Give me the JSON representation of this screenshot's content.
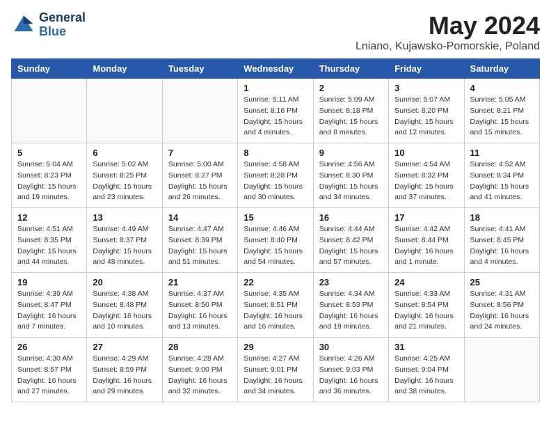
{
  "header": {
    "logo_general": "General",
    "logo_blue": "Blue",
    "month_title": "May 2024",
    "location": "Lniano, Kujawsko-Pomorskie, Poland"
  },
  "weekdays": [
    "Sunday",
    "Monday",
    "Tuesday",
    "Wednesday",
    "Thursday",
    "Friday",
    "Saturday"
  ],
  "weeks": [
    [
      {
        "day": "",
        "info": ""
      },
      {
        "day": "",
        "info": ""
      },
      {
        "day": "",
        "info": ""
      },
      {
        "day": "1",
        "info": "Sunrise: 5:11 AM\nSunset: 8:16 PM\nDaylight: 15 hours\nand 4 minutes."
      },
      {
        "day": "2",
        "info": "Sunrise: 5:09 AM\nSunset: 8:18 PM\nDaylight: 15 hours\nand 8 minutes."
      },
      {
        "day": "3",
        "info": "Sunrise: 5:07 AM\nSunset: 8:20 PM\nDaylight: 15 hours\nand 12 minutes."
      },
      {
        "day": "4",
        "info": "Sunrise: 5:05 AM\nSunset: 8:21 PM\nDaylight: 15 hours\nand 15 minutes."
      }
    ],
    [
      {
        "day": "5",
        "info": "Sunrise: 5:04 AM\nSunset: 8:23 PM\nDaylight: 15 hours\nand 19 minutes."
      },
      {
        "day": "6",
        "info": "Sunrise: 5:02 AM\nSunset: 8:25 PM\nDaylight: 15 hours\nand 23 minutes."
      },
      {
        "day": "7",
        "info": "Sunrise: 5:00 AM\nSunset: 8:27 PM\nDaylight: 15 hours\nand 26 minutes."
      },
      {
        "day": "8",
        "info": "Sunrise: 4:58 AM\nSunset: 8:28 PM\nDaylight: 15 hours\nand 30 minutes."
      },
      {
        "day": "9",
        "info": "Sunrise: 4:56 AM\nSunset: 8:30 PM\nDaylight: 15 hours\nand 34 minutes."
      },
      {
        "day": "10",
        "info": "Sunrise: 4:54 AM\nSunset: 8:32 PM\nDaylight: 15 hours\nand 37 minutes."
      },
      {
        "day": "11",
        "info": "Sunrise: 4:52 AM\nSunset: 8:34 PM\nDaylight: 15 hours\nand 41 minutes."
      }
    ],
    [
      {
        "day": "12",
        "info": "Sunrise: 4:51 AM\nSunset: 8:35 PM\nDaylight: 15 hours\nand 44 minutes."
      },
      {
        "day": "13",
        "info": "Sunrise: 4:49 AM\nSunset: 8:37 PM\nDaylight: 15 hours\nand 48 minutes."
      },
      {
        "day": "14",
        "info": "Sunrise: 4:47 AM\nSunset: 8:39 PM\nDaylight: 15 hours\nand 51 minutes."
      },
      {
        "day": "15",
        "info": "Sunrise: 4:46 AM\nSunset: 8:40 PM\nDaylight: 15 hours\nand 54 minutes."
      },
      {
        "day": "16",
        "info": "Sunrise: 4:44 AM\nSunset: 8:42 PM\nDaylight: 15 hours\nand 57 minutes."
      },
      {
        "day": "17",
        "info": "Sunrise: 4:42 AM\nSunset: 8:44 PM\nDaylight: 16 hours\nand 1 minute."
      },
      {
        "day": "18",
        "info": "Sunrise: 4:41 AM\nSunset: 8:45 PM\nDaylight: 16 hours\nand 4 minutes."
      }
    ],
    [
      {
        "day": "19",
        "info": "Sunrise: 4:39 AM\nSunset: 8:47 PM\nDaylight: 16 hours\nand 7 minutes."
      },
      {
        "day": "20",
        "info": "Sunrise: 4:38 AM\nSunset: 8:48 PM\nDaylight: 16 hours\nand 10 minutes."
      },
      {
        "day": "21",
        "info": "Sunrise: 4:37 AM\nSunset: 8:50 PM\nDaylight: 16 hours\nand 13 minutes."
      },
      {
        "day": "22",
        "info": "Sunrise: 4:35 AM\nSunset: 8:51 PM\nDaylight: 16 hours\nand 16 minutes."
      },
      {
        "day": "23",
        "info": "Sunrise: 4:34 AM\nSunset: 8:53 PM\nDaylight: 16 hours\nand 19 minutes."
      },
      {
        "day": "24",
        "info": "Sunrise: 4:33 AM\nSunset: 8:54 PM\nDaylight: 16 hours\nand 21 minutes."
      },
      {
        "day": "25",
        "info": "Sunrise: 4:31 AM\nSunset: 8:56 PM\nDaylight: 16 hours\nand 24 minutes."
      }
    ],
    [
      {
        "day": "26",
        "info": "Sunrise: 4:30 AM\nSunset: 8:57 PM\nDaylight: 16 hours\nand 27 minutes."
      },
      {
        "day": "27",
        "info": "Sunrise: 4:29 AM\nSunset: 8:59 PM\nDaylight: 16 hours\nand 29 minutes."
      },
      {
        "day": "28",
        "info": "Sunrise: 4:28 AM\nSunset: 9:00 PM\nDaylight: 16 hours\nand 32 minutes."
      },
      {
        "day": "29",
        "info": "Sunrise: 4:27 AM\nSunset: 9:01 PM\nDaylight: 16 hours\nand 34 minutes."
      },
      {
        "day": "30",
        "info": "Sunrise: 4:26 AM\nSunset: 9:03 PM\nDaylight: 16 hours\nand 36 minutes."
      },
      {
        "day": "31",
        "info": "Sunrise: 4:25 AM\nSunset: 9:04 PM\nDaylight: 16 hours\nand 38 minutes."
      },
      {
        "day": "",
        "info": ""
      }
    ]
  ]
}
